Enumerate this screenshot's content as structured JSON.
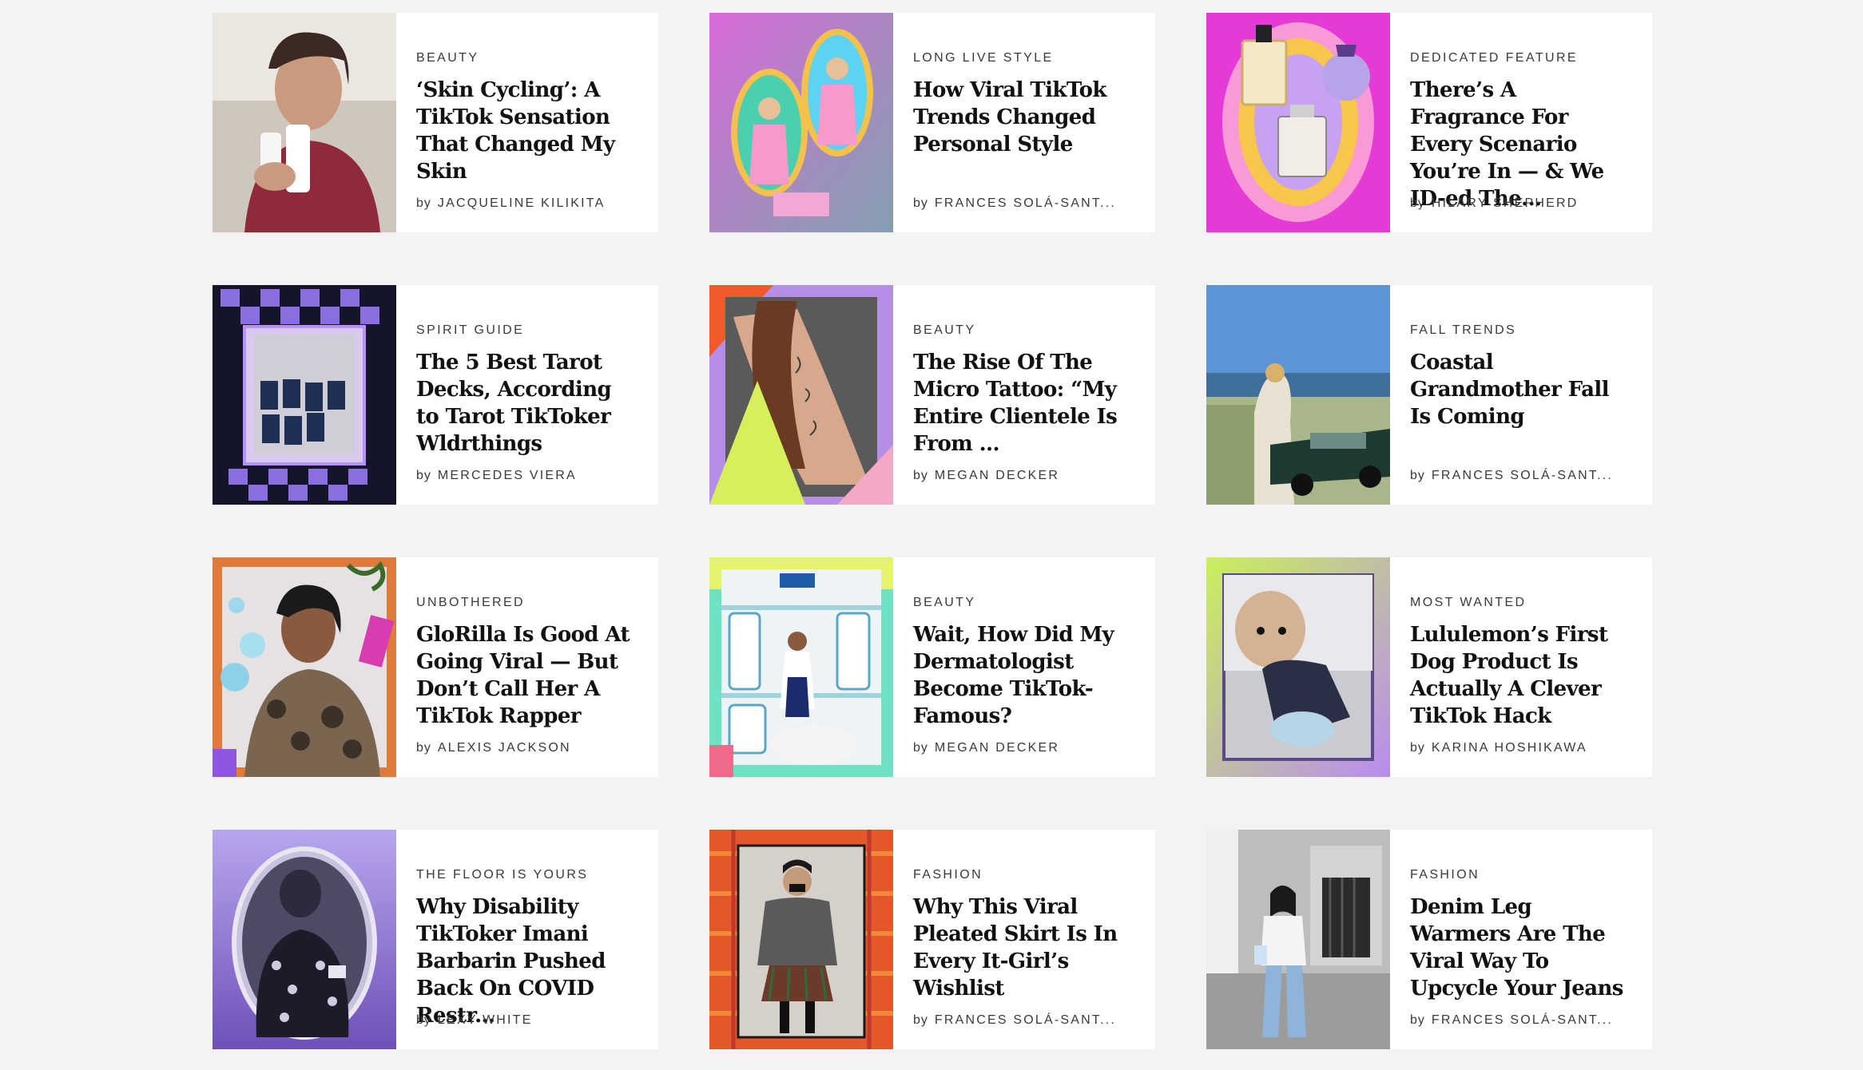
{
  "articles": [
    {
      "kicker": "BEAUTY",
      "headline": "‘Skin Cycling’: A TikTok Sensation That Changed My Skin",
      "by": "by",
      "author": "JACQUELINE KILIKITA"
    },
    {
      "kicker": "LONG LIVE STYLE",
      "headline": "How Viral TikTok Trends Changed Personal Style",
      "by": "by",
      "author": "FRANCES SOLÁ-SANT..."
    },
    {
      "kicker": "DEDICATED FEATURE",
      "headline": "There’s A Fragrance For Every Scenario You’re In — & We ID-ed The...",
      "by": "by",
      "author": "HILARY SHEPHERD"
    },
    {
      "kicker": "SPIRIT GUIDE",
      "headline": "The 5 Best Tarot Decks, According to Tarot TikToker Wldrthings",
      "by": "by",
      "author": "MERCEDES VIERA"
    },
    {
      "kicker": "BEAUTY",
      "headline": "The Rise Of The Micro Tattoo: “My Entire Clientele Is From ...",
      "by": "by",
      "author": "MEGAN DECKER"
    },
    {
      "kicker": "FALL TRENDS",
      "headline": "Coastal Grandmother Fall Is Coming",
      "by": "by",
      "author": "FRANCES SOLÁ-SANT..."
    },
    {
      "kicker": "UNBOTHERED",
      "headline": "GloRilla Is Good At Going Viral — But Don’t Call Her A TikTok Rapper",
      "by": "by",
      "author": "ALEXIS JACKSON"
    },
    {
      "kicker": "BEAUTY",
      "headline": "Wait, How Did My Dermatologist Become TikTok-Famous?",
      "by": "by",
      "author": "MEGAN DECKER"
    },
    {
      "kicker": "MOST WANTED",
      "headline": "Lululemon’s First Dog Product Is Actually A Clever TikTok Hack",
      "by": "by",
      "author": "KARINA HOSHIKAWA"
    },
    {
      "kicker": "THE FLOOR IS YOURS",
      "headline": "Why Disability TikToker Imani Barbarin Pushed Back On COVID Restr...",
      "by": "by",
      "author": "LEXY WHITE"
    },
    {
      "kicker": "FASHION",
      "headline": "Why This Viral Pleated Skirt Is In Every It-Girl’s Wishlist",
      "by": "by",
      "author": "FRANCES SOLÁ-SANT..."
    },
    {
      "kicker": "FASHION",
      "headline": "Denim Leg Warmers Are The Viral Way To Upcycle Your Jeans",
      "by": "by",
      "author": "FRANCES SOLÁ-SANT..."
    }
  ],
  "thumbs": [
    {
      "name": "woman-skincare-photo",
      "bg": "#9a2f3d"
    },
    {
      "name": "pink-dress-collage-photo",
      "bg": "#9b6be0"
    },
    {
      "name": "perfume-bottles-photo",
      "bg": "#e53ad5"
    },
    {
      "name": "tarot-deck-photo",
      "bg": "#1b1b2b"
    },
    {
      "name": "arm-tattoo-photo",
      "bg": "#f05a2c"
    },
    {
      "name": "coastal-car-photo",
      "bg": "#5f8fc9"
    },
    {
      "name": "glorilla-collage-photo",
      "bg": "#e06a32"
    },
    {
      "name": "dermatologist-cerave-photo",
      "bg": "#6ee0c8"
    },
    {
      "name": "dog-jacket-photo",
      "bg": "#9be356"
    },
    {
      "name": "imani-barbarin-photo",
      "bg": "#8b5fc6"
    },
    {
      "name": "pleated-skirt-photo",
      "bg": "#e3572b"
    },
    {
      "name": "denim-leg-warmers-photo",
      "bg": "#8d8d8d"
    }
  ]
}
